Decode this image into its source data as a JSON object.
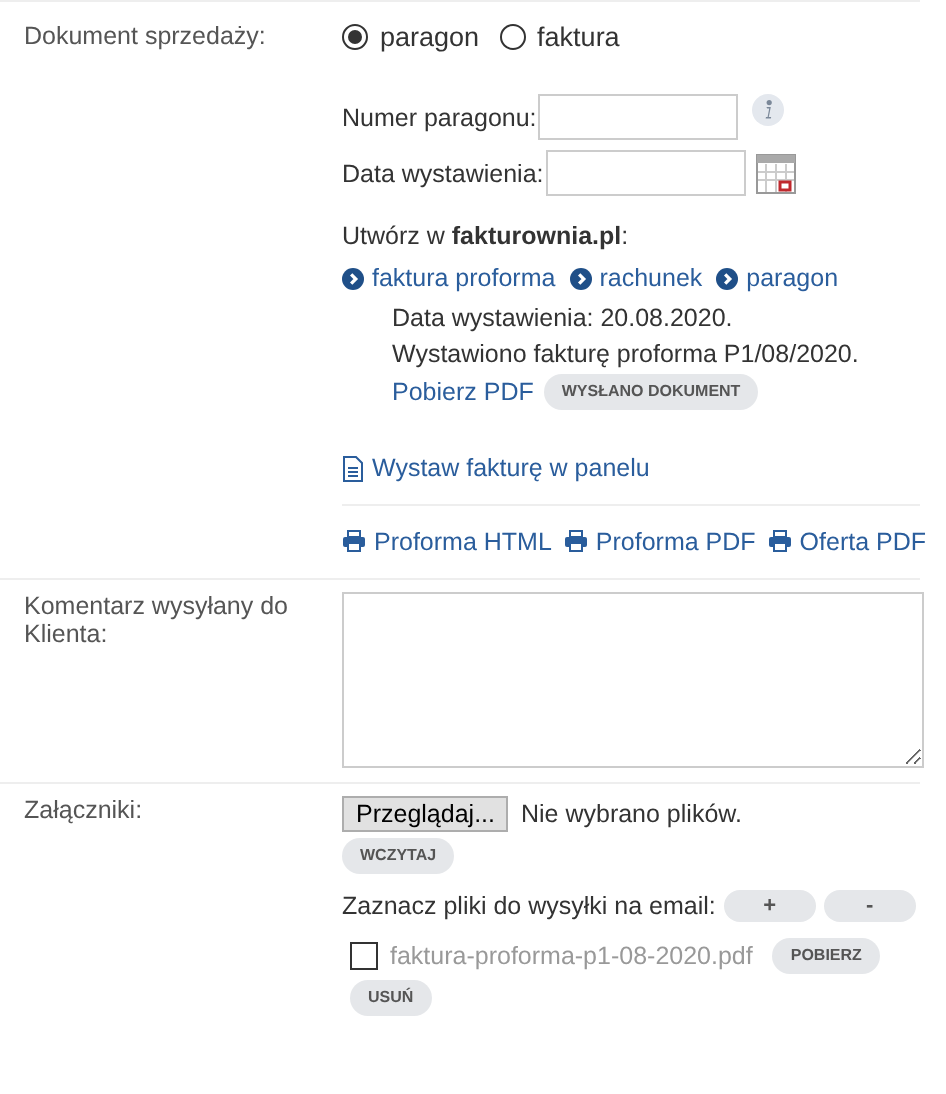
{
  "sale_document": {
    "label": "Dokument sprzedaży:",
    "options": [
      {
        "label": "paragon",
        "selected": true
      },
      {
        "label": "faktura",
        "selected": false
      }
    ],
    "fields": [
      {
        "label": "Numer paragonu:",
        "kind": "info"
      },
      {
        "label": "Data wystawienia:",
        "kind": "date"
      }
    ],
    "create_heading": "Utwórz w **fakturownia.pl**:",
    "create_links": [
      "faktura proforma",
      "rachunek",
      "paragon"
    ],
    "issue_details": [
      "Data wystawienia: 20.08.2020.",
      "Wystawiono fakturę proforma P1/08/2020."
    ],
    "download_link": "Pobierz PDF",
    "sent_badge": "WYSŁANO DOKUMENT",
    "panel_link": "Wystaw fakturę w panelu",
    "print_links": [
      "Proforma HTML",
      "Proforma PDF",
      "Oferta PDF"
    ]
  },
  "comment": {
    "label": "Komentarz wysyłany do Klienta:"
  },
  "attachments": {
    "label": "Załączniki:",
    "browse_button": "Przeglądaj...",
    "file_status": "Nie wybrano plików.",
    "upload_button": "WCZYTAJ",
    "email_label": "Zaznacz pliki do wysyłki na email:",
    "add_button": "+",
    "remove_button": "-",
    "files": [
      {
        "name": "faktura-proforma-p1-08-2020.pdf",
        "checked": false,
        "download_button": "POBIERZ",
        "delete_button": "USUŃ"
      }
    ]
  }
}
